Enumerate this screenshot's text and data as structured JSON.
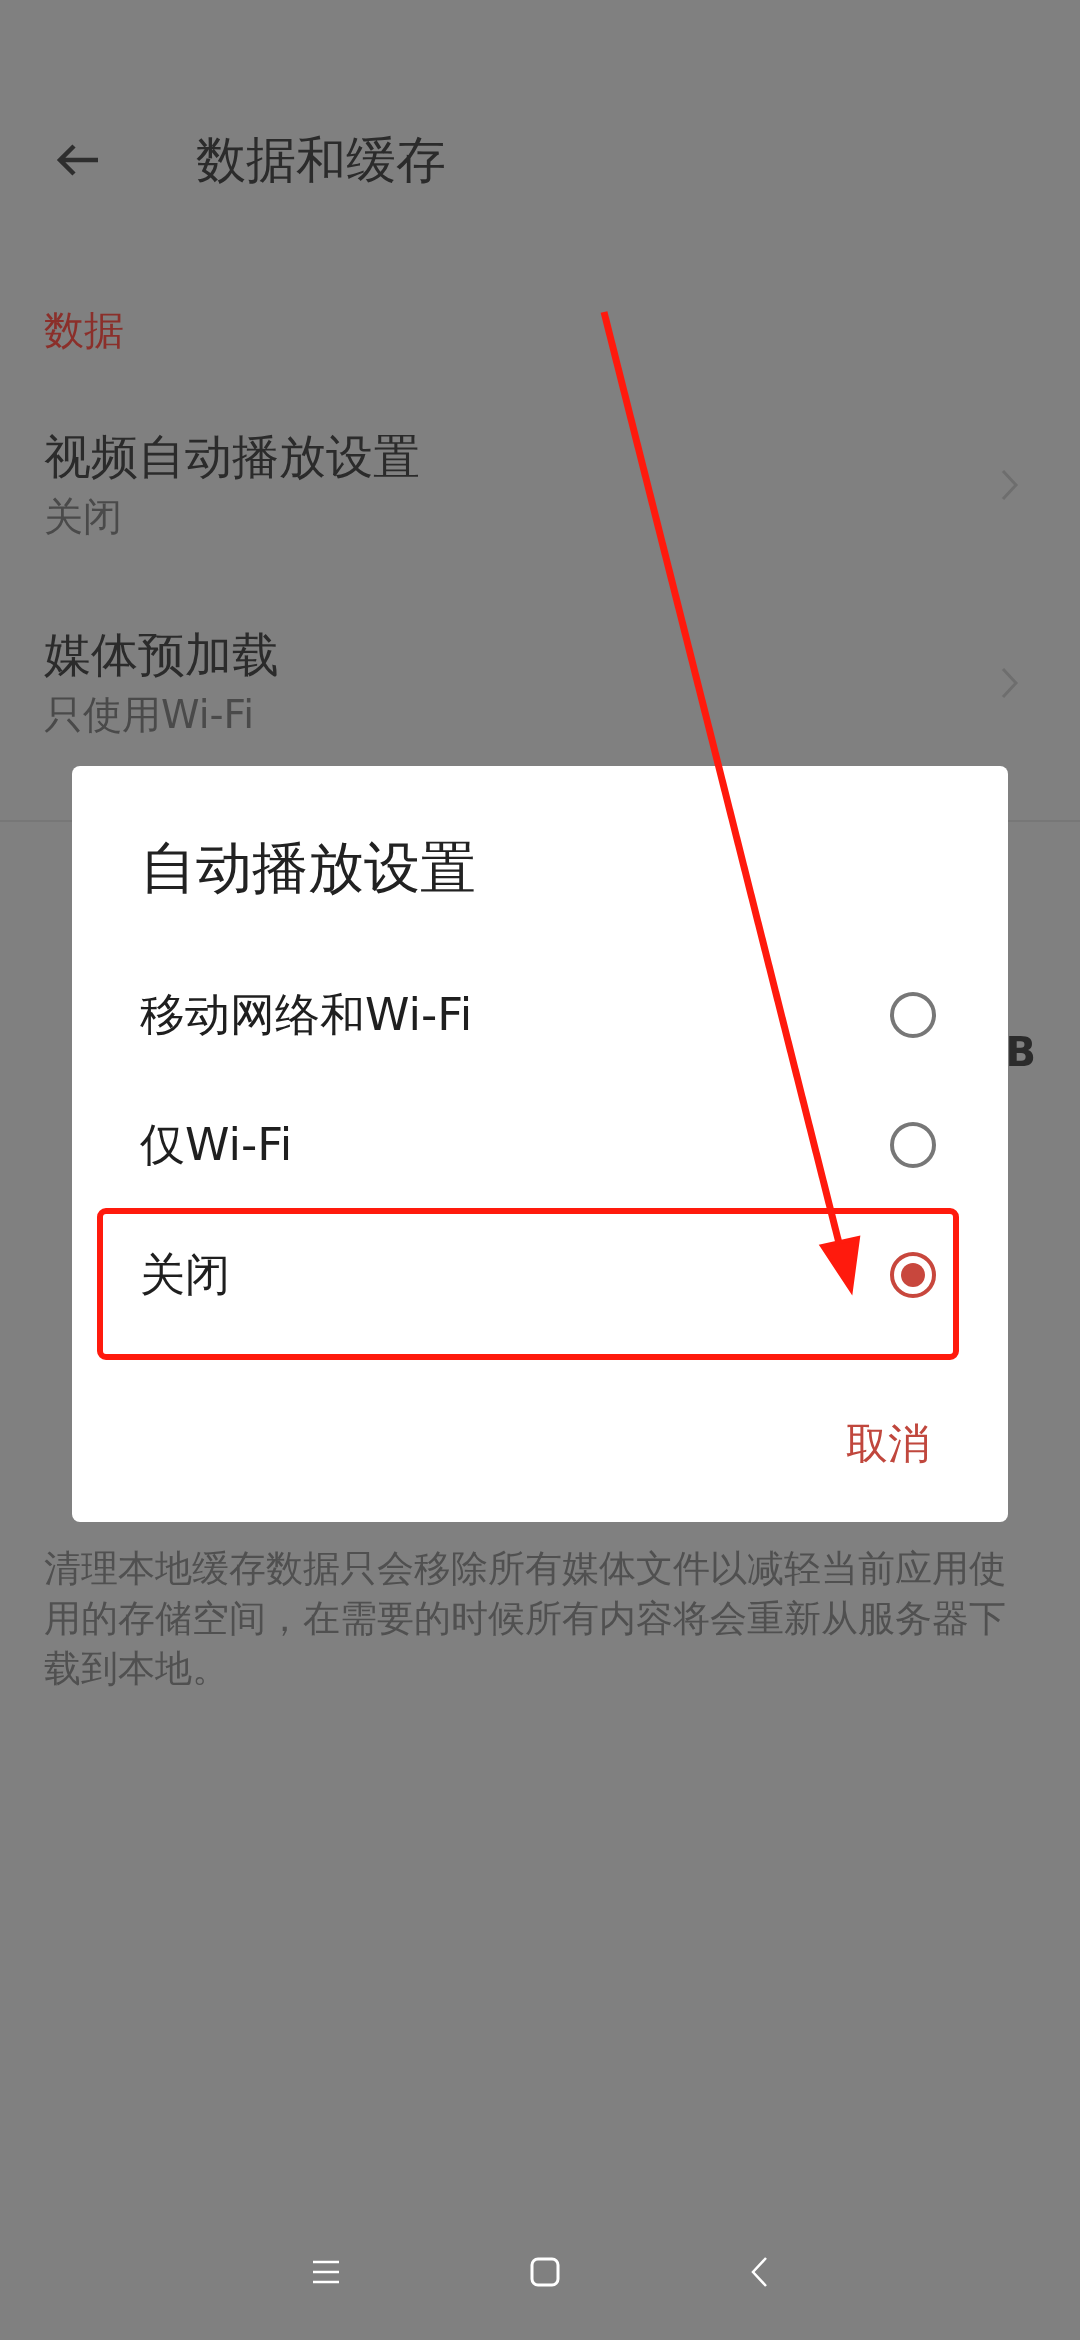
{
  "header": {
    "title": "数据和缓存"
  },
  "sections": [
    {
      "title": "数据",
      "items": [
        {
          "title": "视频自动播放设置",
          "value": "关闭"
        },
        {
          "title": "媒体预加载",
          "value": "只使用Wi-Fi"
        }
      ]
    }
  ],
  "cache_row": {
    "value": "B"
  },
  "footnote": "清理本地缓存数据只会移除所有媒体文件以减轻当前应用使用的存储空间，在需要的时候所有内容将会重新从服务器下载到本地。",
  "dialog": {
    "title": "自动播放设置",
    "options": [
      {
        "label": "移动网络和Wi-Fi",
        "selected": false
      },
      {
        "label": "仅Wi-Fi",
        "selected": false
      },
      {
        "label": "关闭",
        "selected": true
      }
    ],
    "cancel": "取消"
  }
}
